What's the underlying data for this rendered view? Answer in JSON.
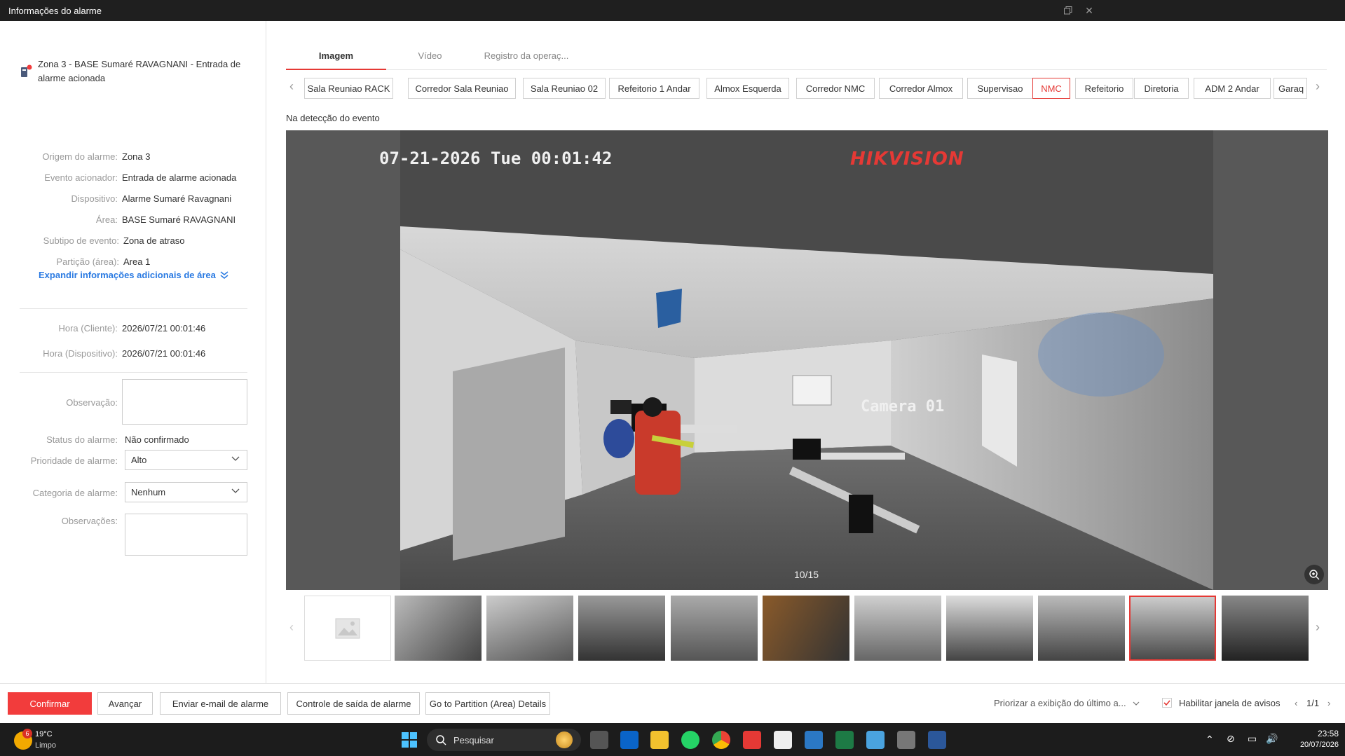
{
  "window": {
    "title": "Informações do alarme"
  },
  "alarm_header": {
    "text": "Zona 3 - BASE Sumaré RAVAGNANI - Entrada de alarme acionada"
  },
  "details": [
    {
      "label": "Origem do alarme:",
      "value": "Zona 3"
    },
    {
      "label": "Evento acionador:",
      "value": "Entrada de alarme acionada"
    },
    {
      "label": "Dispositivo:",
      "value": "Alarme Sumaré Ravagnani"
    },
    {
      "label": "Área:",
      "value": "BASE Sumaré RAVAGNANI"
    },
    {
      "label": "Subtipo de evento:",
      "value": "Zona de atraso"
    },
    {
      "label": "Partição (área):",
      "value": "Area 1"
    }
  ],
  "expand_link": "Expandir informações adicionais de área",
  "times": [
    {
      "label": "Hora (Cliente):",
      "value": "2026/07/21 00:01:46"
    },
    {
      "label": "Hora (Dispositivo):",
      "value": "2026/07/21 00:01:46"
    }
  ],
  "form": {
    "observation_label": "Observação:",
    "status_label": "Status do alarme:",
    "status_value": "Não confirmado",
    "priority_label": "Prioridade de alarme:",
    "priority_value": "Alto",
    "category_label": "Categoria de alarme:",
    "category_value": "Nenhum",
    "remarks_label": "Observações:"
  },
  "tabs": [
    "Imagem",
    "Vídeo",
    "Registro da operaç..."
  ],
  "cameras": [
    "Sala Reuniao RACK",
    "Corredor Sala Reuniao",
    "Sala Reuniao 02",
    "Refeitorio 1 Andar",
    "Almox Esquerda",
    "Corredor NMC",
    "Corredor Almox",
    "Supervisao",
    "NMC",
    "Refeitorio",
    "Diretoria",
    "ADM 2 Andar",
    "Garaq"
  ],
  "selected_camera": "NMC",
  "event_note": "Na detecção do evento",
  "video": {
    "osd_datetime": "07-21-2026 Tue 00:01:42",
    "brand": "HIKVISION",
    "camera_label": "Camera 01",
    "counter": "10/15"
  },
  "footer": {
    "confirm": "Confirmar",
    "advance": "Avançar",
    "send_email": "Enviar e-mail de alarme",
    "output_control": "Controle de saída de alarme",
    "partition_details": "Go to Partition (Area) Details",
    "prioritize": "Priorizar a exibição do último a...",
    "enable_popup": "Habilitar janela de avisos",
    "pagination": "1/1"
  },
  "taskbar": {
    "weather_temp": "19°C",
    "weather_desc": "Limpo",
    "weather_badge": "6",
    "search_placeholder": "Pesquisar",
    "time": "23:58",
    "date": "20/07/2026"
  },
  "colors": {
    "accent": "#f23c3c",
    "link": "#2a7ae2",
    "titlebar": "#1f1f1f",
    "taskbar": "#1c1c1c"
  }
}
